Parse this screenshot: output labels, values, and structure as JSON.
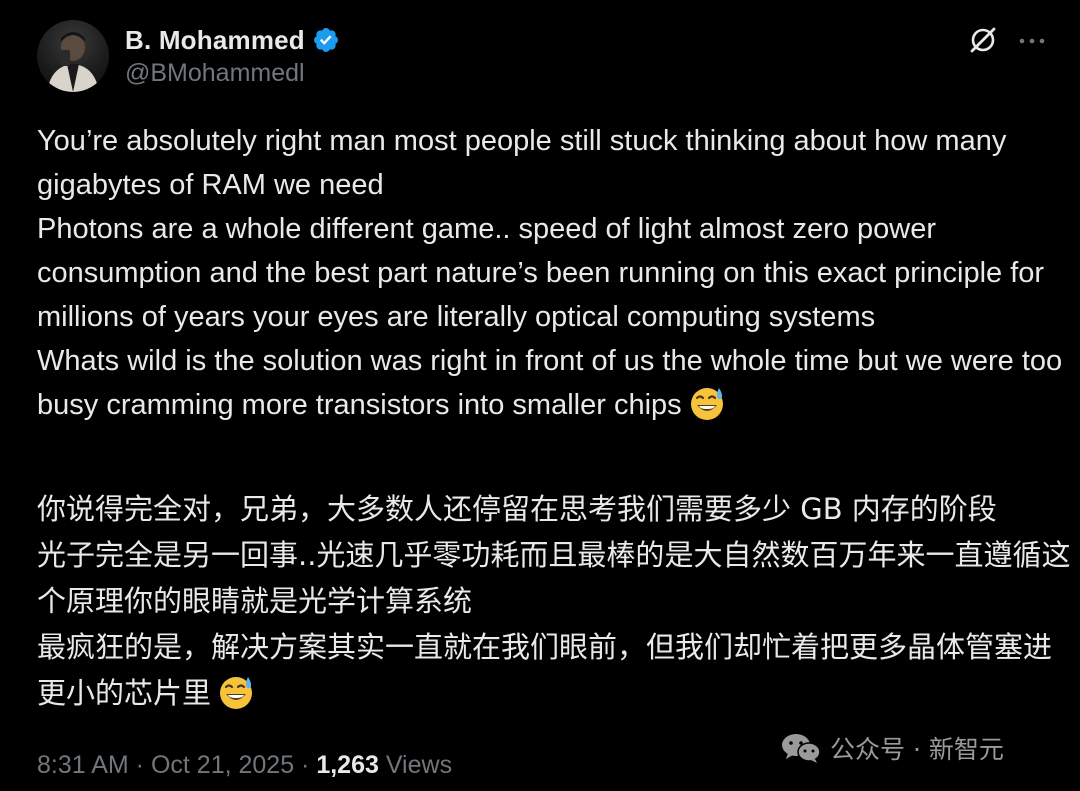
{
  "author": {
    "display_name": "B. Mohammed",
    "handle": "@BMohammedl",
    "verified": true
  },
  "icons": {
    "verified_badge": "verified-badge-icon",
    "grok": "grok-icon",
    "more": "more-icon",
    "emoji": "sweat-smile-emoji-icon",
    "wechat": "wechat-icon"
  },
  "tweet": {
    "english_lines": [
      "You’re absolutely right man most people still stuck thinking about how many gigabytes of RAM we need",
      "Photons are a whole different game.. speed of light almost zero power consumption and the best part nature’s been running on this exact principle for millions of years your eyes are literally optical computing systems",
      "Whats wild is the solution was right in front of us the whole time but we were too busy cramming more transistors into smaller chips"
    ],
    "chinese_lines": [
      "你说得完全对，兄弟，大多数人还停留在思考我们需要多少 GB 内存的阶段",
      "光子完全是另一回事..光速几乎零功耗而且最棒的是大自然数百万年来一直遵循这个原理你的眼睛就是光学计算系统",
      "最疯狂的是，解决方案其实一直就在我们眼前，但我们却忙着把更多晶体管塞进更小的芯片里"
    ]
  },
  "meta": {
    "time": "8:31 AM",
    "separator": " · ",
    "date": "Oct 21, 2025",
    "views_count": "1,263",
    "views_label": " Views"
  },
  "watermark": {
    "text": "公众号 · 新智元"
  },
  "colors": {
    "background": "#000000",
    "text": "#e7e9ea",
    "secondary": "#71767b",
    "verified": "#1d9bf0"
  }
}
